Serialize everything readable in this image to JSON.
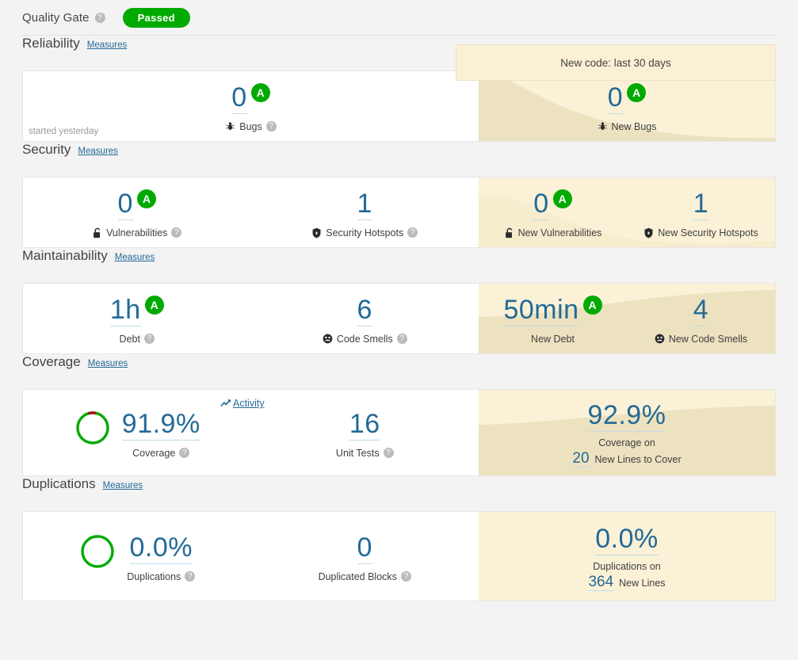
{
  "quality_gate": {
    "label": "Quality Gate",
    "help": "?",
    "status": "Passed",
    "status_color": "#00aa00"
  },
  "new_code_header": "New code: last 30 days",
  "sections": [
    {
      "title": "Reliability",
      "link": "Measures",
      "footnote": "started yesterday",
      "overall": [
        {
          "value": "0",
          "rating": "A",
          "icon": "bug-icon",
          "label": "Bugs",
          "help": "?"
        }
      ],
      "new_code": [
        {
          "value": "0",
          "rating": "A",
          "icon": "bug-icon",
          "label": "New Bugs"
        }
      ]
    },
    {
      "title": "Security",
      "link": "Measures",
      "overall": [
        {
          "value": "0",
          "rating": "A",
          "icon": "unlock-icon",
          "label": "Vulnerabilities",
          "help": "?"
        },
        {
          "value": "1",
          "icon": "shield-icon",
          "label": "Security Hotspots",
          "help": "?"
        }
      ],
      "new_code": [
        {
          "value": "0",
          "rating": "A",
          "icon": "unlock-icon",
          "label": "New Vulnerabilities"
        },
        {
          "value": "1",
          "icon": "shield-icon",
          "label": "New Security Hotspots"
        }
      ]
    },
    {
      "title": "Maintainability",
      "link": "Measures",
      "overall": [
        {
          "value": "1h",
          "rating": "A",
          "label": "Debt",
          "help": "?"
        },
        {
          "value": "6",
          "icon": "code-smell-icon",
          "label": "Code Smells",
          "help": "?"
        }
      ],
      "new_code": [
        {
          "value": "50min",
          "rating": "A",
          "label": "New Debt"
        },
        {
          "value": "4",
          "icon": "code-smell-icon",
          "label": "New Code Smells"
        }
      ]
    },
    {
      "title": "Coverage",
      "link": "Measures",
      "activity_link": "Activity",
      "overall": [
        {
          "value": "91.9%",
          "donut": true,
          "label": "Coverage",
          "help": "?"
        },
        {
          "value": "16",
          "label": "Unit Tests",
          "help": "?"
        }
      ],
      "new_code": [
        {
          "value": "92.9%",
          "sub_line": "Coverage on",
          "mini_value": "20",
          "mini_label": "New Lines to Cover"
        }
      ]
    },
    {
      "title": "Duplications",
      "link": "Measures",
      "overall": [
        {
          "value": "0.0%",
          "donut_full": true,
          "label": "Duplications",
          "help": "?"
        },
        {
          "value": "0",
          "label": "Duplicated Blocks",
          "help": "?"
        }
      ],
      "new_code": [
        {
          "value": "0.0%",
          "sub_line": "Duplications on",
          "mini_value": "364",
          "mini_label": "New Lines"
        }
      ]
    }
  ],
  "chart_data": {
    "type": "pie",
    "title": "Coverage donut",
    "categories": [
      "Covered",
      "Uncovered"
    ],
    "values": [
      91.9,
      8.1
    ],
    "colors": [
      "#00aa00",
      "#a4161a"
    ]
  },
  "colors": {
    "accent_blue": "#236a97",
    "rating_green": "#00aa00",
    "new_code_bg": "#f9f0d6",
    "new_code_bg_dark": "#ece2c0",
    "page_bg": "#f3f3f3"
  }
}
